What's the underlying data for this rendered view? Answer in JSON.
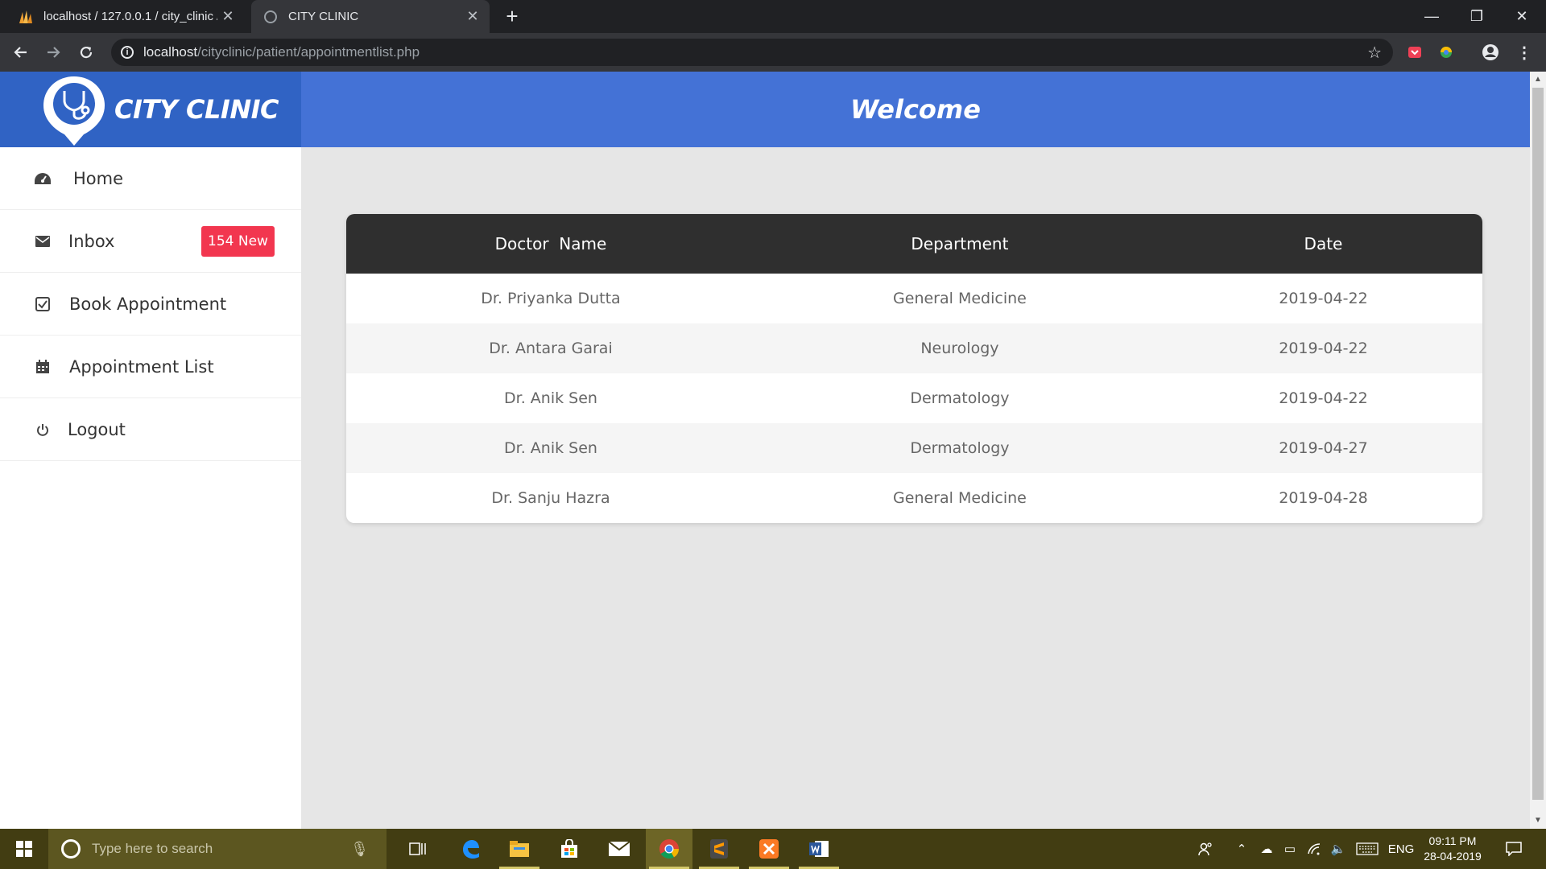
{
  "browser": {
    "tabs": [
      {
        "title": "localhost / 127.0.0.1 / city_clinic /",
        "active": false
      },
      {
        "title": "CITY CLINIC",
        "active": true
      }
    ],
    "url_host": "localhost",
    "url_path": "/cityclinic/patient/appointmentlist.php"
  },
  "brand": {
    "name": "CITY CLINIC"
  },
  "header": {
    "title": "Welcome"
  },
  "sidebar": {
    "items": [
      {
        "label": "Home",
        "icon": "dashboard-icon"
      },
      {
        "label": "Inbox",
        "icon": "envelope-icon",
        "badge": "154 New"
      },
      {
        "label": "Book Appointment",
        "icon": "checkbox-icon"
      },
      {
        "label": "Appointment List",
        "icon": "calendar-icon"
      },
      {
        "label": "Logout",
        "icon": "power-icon"
      }
    ]
  },
  "table": {
    "headers": [
      "Doctor  Name",
      "Department",
      "Date"
    ],
    "rows": [
      [
        "Dr. Priyanka Dutta",
        "General Medicine",
        "2019-04-22"
      ],
      [
        "Dr. Antara Garai",
        "Neurology",
        "2019-04-22"
      ],
      [
        "Dr. Anik Sen",
        "Dermatology",
        "2019-04-22"
      ],
      [
        "Dr. Anik Sen",
        "Dermatology",
        "2019-04-27"
      ],
      [
        "Dr. Sanju Hazra",
        "General Medicine",
        "2019-04-28"
      ]
    ]
  },
  "taskbar": {
    "search_placeholder": "Type here to search",
    "language": "ENG",
    "time": "09:11 PM",
    "date": "28-04-2019"
  },
  "colors": {
    "brand_bg": "#3063c4",
    "header_bg": "#4472d6",
    "badge": "#f2364f",
    "table_head": "#2f2f2f"
  }
}
